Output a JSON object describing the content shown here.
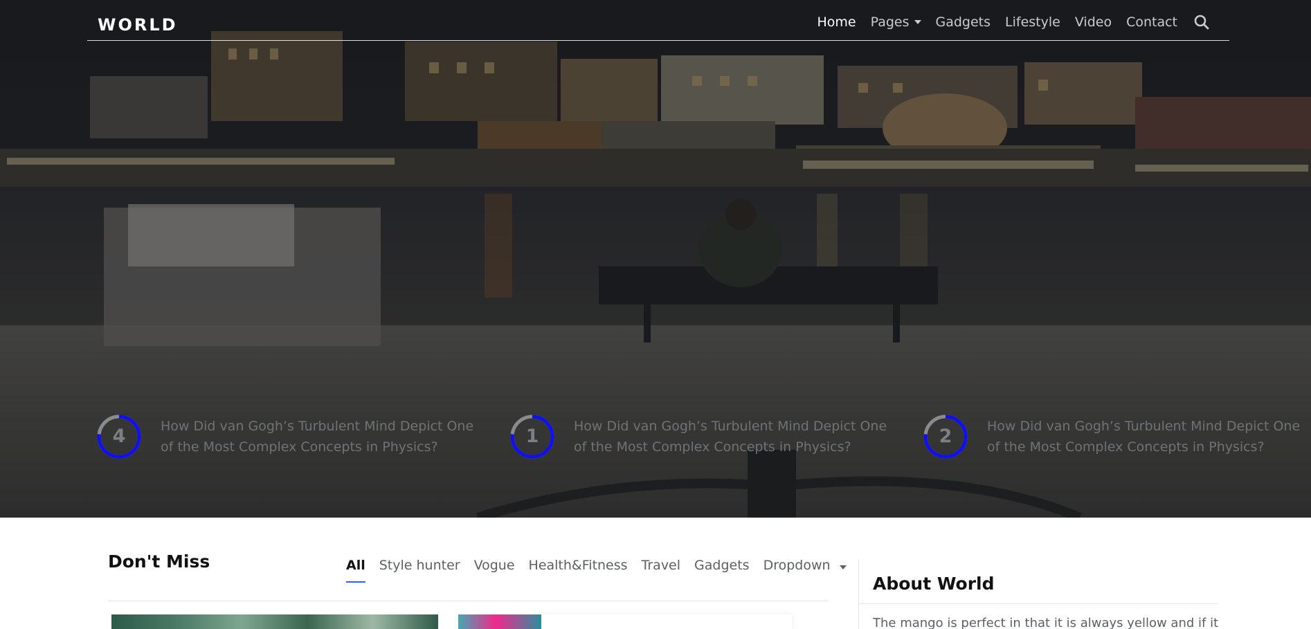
{
  "brand": {
    "logo": "WORLD"
  },
  "nav": {
    "items": [
      {
        "label": "Home",
        "active": true
      },
      {
        "label": "Pages",
        "dropdown": true
      },
      {
        "label": "Gadgets"
      },
      {
        "label": "Lifestyle"
      },
      {
        "label": "Video"
      },
      {
        "label": "Contact"
      }
    ],
    "search_icon": "search-icon"
  },
  "hero": {
    "trending": [
      {
        "number": "4",
        "text": "How Did van Gogh’s Turbulent Mind Depict One of the Most Complex Concepts in Physics?"
      },
      {
        "number": "1",
        "text": "How Did van Gogh’s Turbulent Mind Depict One of the Most Complex Concepts in Physics?"
      },
      {
        "number": "2",
        "text": "How Did van Gogh’s Turbulent Mind Depict One of the Most Complex Concepts in Physics?"
      }
    ],
    "ring_colors": {
      "track": "#8a8b8f",
      "progress": "#1010ee"
    }
  },
  "dont_miss": {
    "title": "Don't Miss",
    "tabs": [
      {
        "label": "All",
        "active": true
      },
      {
        "label": "Style hunter"
      },
      {
        "label": "Vogue"
      },
      {
        "label": "Health&Fitness"
      },
      {
        "label": "Travel"
      },
      {
        "label": "Gadgets"
      },
      {
        "label": "Dropdown",
        "dropdown": true
      }
    ],
    "accent": "#1e66ff"
  },
  "sidebar": {
    "about_title": "About World",
    "about_text": "The mango is perfect in that it is always yellow and if it’s"
  }
}
